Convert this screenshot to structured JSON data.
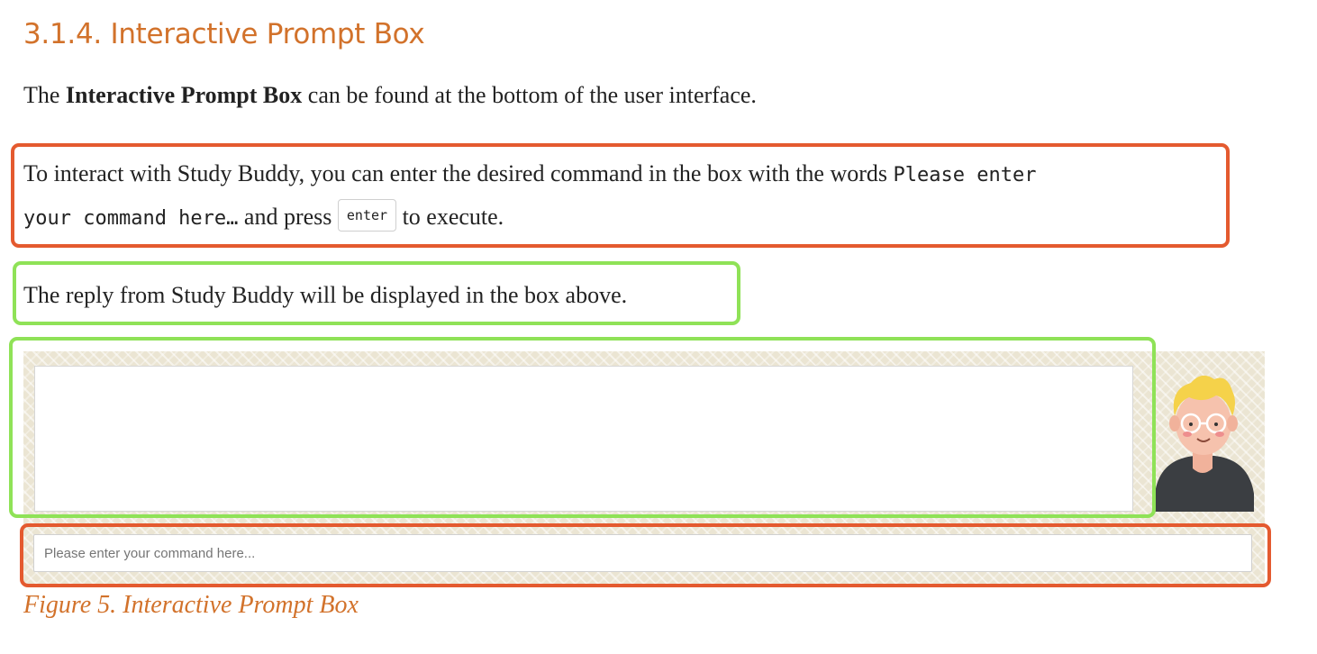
{
  "section": {
    "title": "3.1.4. Interactive Prompt Box"
  },
  "intro": {
    "prefix": "The ",
    "bold": "Interactive Prompt Box",
    "suffix": " can be found at the bottom of the user interface."
  },
  "instruction": {
    "text1": "To interact with Study Buddy, you can enter the desired command in the box with the words ",
    "code_line1": "Please enter",
    "code_line2": "your command here…",
    "text2": " and press ",
    "key": "enter",
    "text3": " to execute."
  },
  "reply_note": {
    "text": "The reply from Study Buddy will be displayed in the box above."
  },
  "figure": {
    "reply_box_text": "",
    "input_placeholder": "Please enter your command here...",
    "caption": "Figure 5. Interactive Prompt Box"
  },
  "colors": {
    "heading": "#d2722b",
    "highlight_red": "#e45a2f",
    "highlight_green": "#8fe257",
    "pattern_bg": "#ebe5d3"
  },
  "icons": {
    "avatar": "cartoon-boy-avatar"
  }
}
